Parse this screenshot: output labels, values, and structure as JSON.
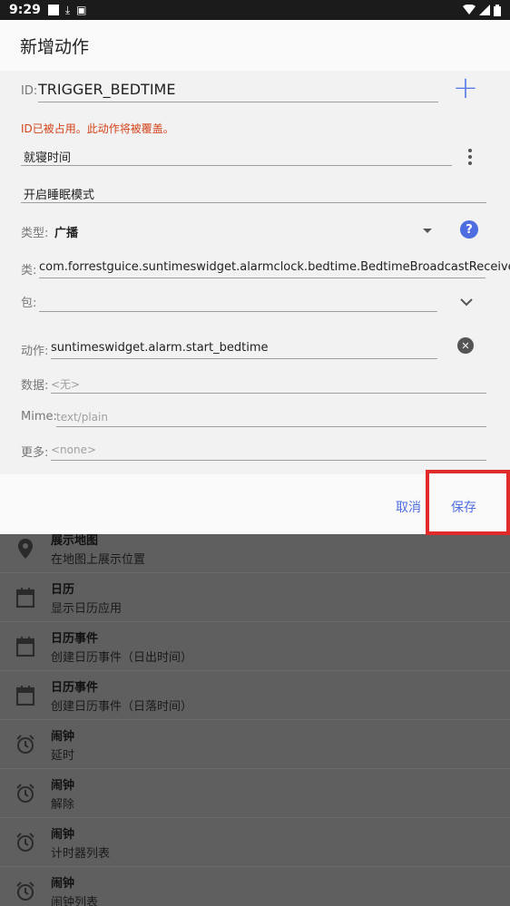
{
  "status_bar": {
    "time": "9:29",
    "icons_left": [
      "square-icon",
      "download-icon",
      "app-icon"
    ],
    "icons_right": [
      "wifi-icon",
      "signal-icon",
      "battery-icon"
    ]
  },
  "dialog": {
    "title": "新增动作",
    "id": {
      "label": "ID:",
      "value": "TRIGGER_BEDTIME"
    },
    "error": "ID已被占用。此动作将被覆盖。",
    "name_value": "就寝时间",
    "desc_value": "开启睡眠模式",
    "type": {
      "label": "类型:",
      "value": "广播"
    },
    "class": {
      "label": "类:",
      "value": "com.forrestguice.suntimeswidget.alarmclock.bedtime.BedtimeBroadcastReceiver"
    },
    "package": {
      "label": "包:",
      "value": ""
    },
    "action": {
      "label": "动作:",
      "value": "suntimeswidget.alarm.start_bedtime"
    },
    "data": {
      "label": "数据:",
      "placeholder": "<无>"
    },
    "mime": {
      "label": "Mime:",
      "placeholder": "text/plain"
    },
    "extras": {
      "label": "更多:",
      "placeholder": "<none>"
    },
    "cancel": "取消",
    "save": "保存"
  },
  "background_list": [
    {
      "icon": "map-pin-icon",
      "title": "展示地图",
      "sub": "在地图上展示位置"
    },
    {
      "icon": "calendar-icon",
      "title": "日历",
      "sub": "显示日历应用"
    },
    {
      "icon": "calendar-icon",
      "title": "日历事件",
      "sub": "创建日历事件（日出时间）"
    },
    {
      "icon": "calendar-icon",
      "title": "日历事件",
      "sub": "创建日历事件（日落时间）"
    },
    {
      "icon": "alarm-icon",
      "title": "闹钟",
      "sub": "延时"
    },
    {
      "icon": "alarm-icon",
      "title": "闹钟",
      "sub": "解除"
    },
    {
      "icon": "alarm-icon",
      "title": "闹钟",
      "sub": "计时器列表"
    },
    {
      "icon": "alarm-icon",
      "title": "闹钟",
      "sub": "闹钟列表"
    }
  ],
  "colors": {
    "accent": "#4d6de0",
    "error": "#d4431a",
    "highlight": "#e12b2b"
  }
}
